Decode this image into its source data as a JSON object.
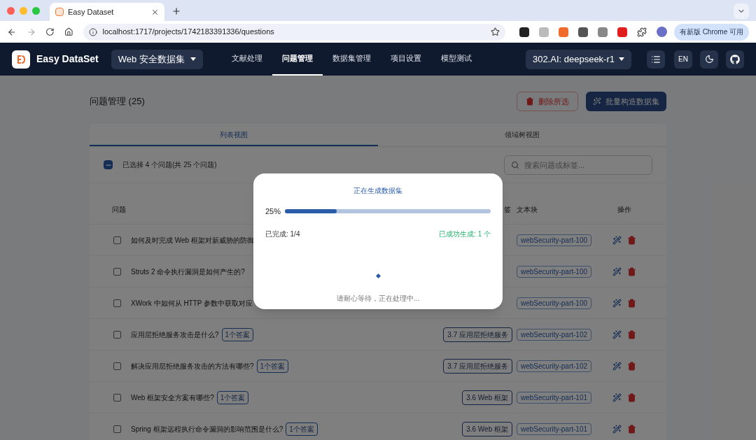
{
  "browser": {
    "tab_title": "Easy Dataset",
    "url": "localhost:1717/projects/1742183391336/questions",
    "update_button": "有新版 Chrome 可用"
  },
  "app": {
    "brand": "Easy DataSet",
    "project": "Web 安全数据集",
    "model": "302.AI: deepseek-r1",
    "lang": "EN",
    "nav": [
      {
        "label": "文献处理",
        "selected": false
      },
      {
        "label": "问题管理",
        "selected": true
      },
      {
        "label": "数据集管理",
        "selected": false
      },
      {
        "label": "项目设置",
        "selected": false
      },
      {
        "label": "模型测试",
        "selected": false
      }
    ]
  },
  "page": {
    "title": "问题管理 (25)",
    "delete_button": "删除所选",
    "batch_button": "批量构造数据集",
    "views": [
      {
        "label": "列表视图",
        "selected": true
      },
      {
        "label": "领域树视图",
        "selected": false
      }
    ],
    "select_all": {
      "indeterminate": true
    },
    "selection_text": "已选择 4 个问题(共 25 个问题)",
    "search": {
      "placeholder": "搜索问题或标签..."
    },
    "columns": {
      "question": "问题",
      "column_2": "签",
      "chunk": "文本块",
      "actions": "操作"
    },
    "rows": [
      {
        "question": "如何及时完成 Web 框架对新威胁的防御",
        "checked": false,
        "chunk": "webSecurity-part-100"
      },
      {
        "question": "Struts 2 命令执行漏洞是如何产生的?",
        "checked": false,
        "chunk": "webSecurity-part-100"
      },
      {
        "question": "XWork 中如何从 HTTP 参数中获取对应",
        "checked": false,
        "chunk": "webSecurity-part-100"
      },
      {
        "question": "应用层拒绝服务攻击是什么?",
        "answers": "1个答案",
        "tag": "3.7 应用层拒绝服务",
        "checked": false,
        "chunk": "webSecurity-part-102"
      },
      {
        "question": "解决应用层拒绝服务攻击的方法有哪些?",
        "answers": "1个答案",
        "tag": "3.7 应用层拒绝服务",
        "checked": false,
        "chunk": "webSecurity-part-102"
      },
      {
        "question": "Web 框架安全方案有哪些?",
        "answers": "1个答案",
        "tag": "3.6 Web 框架",
        "checked": false,
        "chunk": "webSecurity-part-101"
      },
      {
        "question": "Spring 框架远程执行命令漏洞的影响范围是什么?",
        "answers": "1个答案",
        "tag": "3.6 Web 框架",
        "checked": false,
        "chunk": "webSecurity-part-101"
      }
    ]
  },
  "dialog": {
    "title": "正在生成数据集",
    "percent": "25%",
    "level": 0.25,
    "completed": "已完成: 1/4",
    "success": "已成功生成: 1 个",
    "message": "请耐心等待，正在处理中..."
  }
}
